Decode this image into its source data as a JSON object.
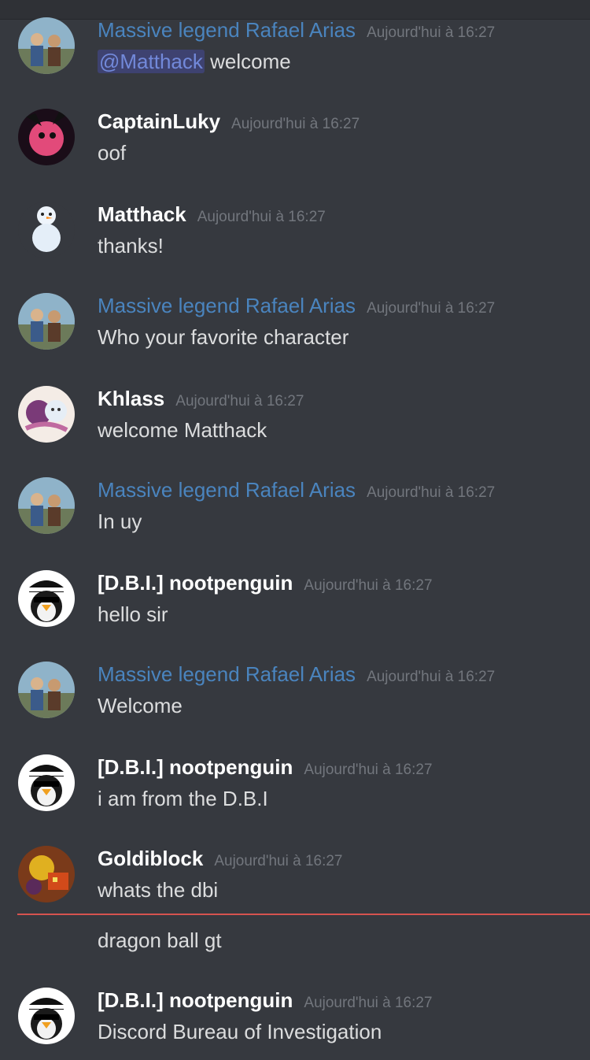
{
  "colors": {
    "background": "#36393f",
    "special_name": "#4a84be",
    "mention": "#7289da",
    "divider": "#d6534f"
  },
  "messages": [
    {
      "author": "Massive legend Rafael Arias",
      "timestamp": "Aujourd'hui à 16:27",
      "mention": "@Matthack",
      "text": " welcome"
    },
    {
      "author": "CaptainLuky",
      "timestamp": "Aujourd'hui à 16:27",
      "text": "oof"
    },
    {
      "author": "Matthack",
      "timestamp": "Aujourd'hui à 16:27",
      "text": "thanks!"
    },
    {
      "author": "Massive legend Rafael Arias",
      "timestamp": "Aujourd'hui à 16:27",
      "text": "Who your favorite character"
    },
    {
      "author": "Khlass",
      "timestamp": "Aujourd'hui à 16:27",
      "text": "welcome Matthack"
    },
    {
      "author": "Massive legend Rafael Arias",
      "timestamp": "Aujourd'hui à 16:27",
      "text": "In uy"
    },
    {
      "author": "[D.B.I.] nootpenguin",
      "timestamp": "Aujourd'hui à 16:27",
      "text": "hello sir"
    },
    {
      "author": "Massive legend Rafael Arias",
      "timestamp": "Aujourd'hui à 16:27",
      "text": "Welcome"
    },
    {
      "author": "[D.B.I.] nootpenguin",
      "timestamp": "Aujourd'hui à 16:27",
      "text": "i am from the D.B.I"
    },
    {
      "author": "Goldiblock",
      "timestamp": "Aujourd'hui à 16:27",
      "text": "whats the dbi"
    },
    {
      "author": "[D.B.I.] nootpenguin",
      "timestamp": "Aujourd'hui à 16:27",
      "text": "Discord Bureau of Investigation"
    }
  ],
  "continuation_text": "dragon ball gt"
}
